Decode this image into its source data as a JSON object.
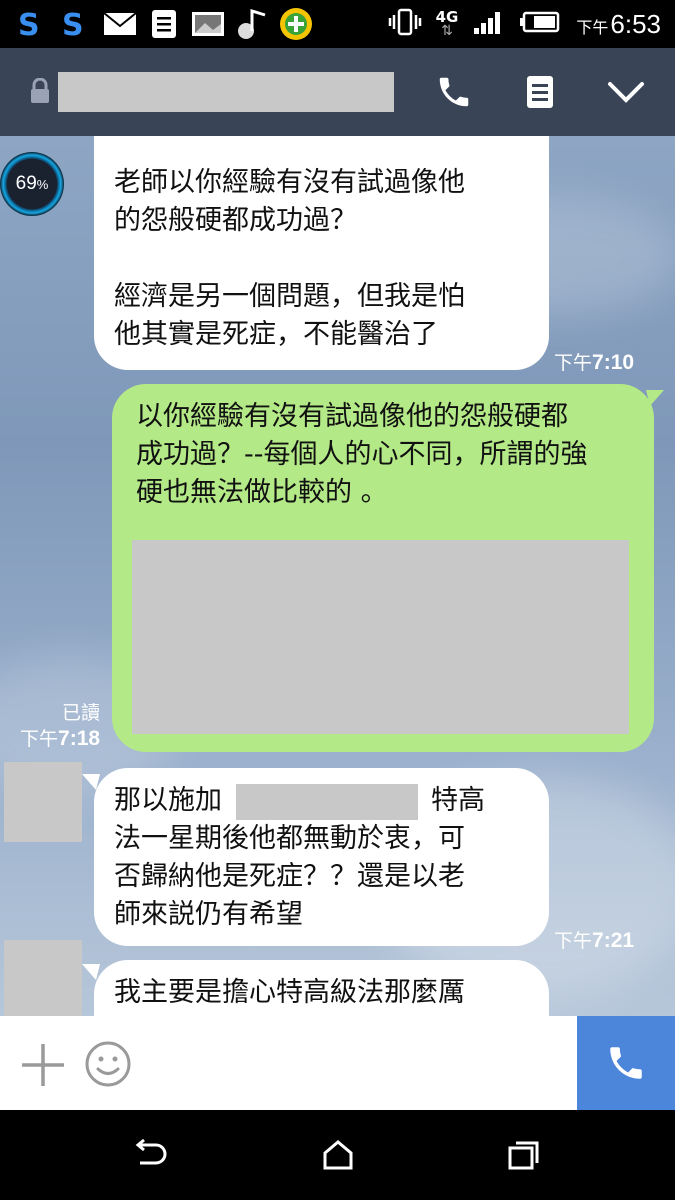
{
  "status_bar": {
    "time_prefix": "下午",
    "time": "6:53",
    "network": "4G"
  },
  "chat": {
    "battery_widget": {
      "value": "69",
      "unit": "%"
    },
    "messages": [
      {
        "direction": "incoming",
        "text": "老師以你經驗有沒有試過像他\n的怨般硬都成功過？\n\n經濟是另一個問題，但我是怕\n他其實是死症，不能醫治了",
        "time_prefix": "下午",
        "time": "7:10"
      },
      {
        "direction": "outgoing",
        "text": "以你經驗有沒有試過像他的怨般硬都\n成功過？--每個人的心不同，所謂的強\n硬也無法做比較的 。",
        "read": "已讀",
        "time_prefix": "下午",
        "time": "7:18"
      },
      {
        "direction": "incoming",
        "text_before": "那以施加",
        "text_after": "，特高",
        "text_rest": "法一星期後他都無動於衷，可\n否歸納他是死症？？還是以老\n師來説仍有希望",
        "time_prefix": "下午",
        "time": "7:21"
      },
      {
        "direction": "incoming",
        "text": "我主要是擔心特高級法那麼厲"
      }
    ]
  },
  "colors": {
    "header_bg": "#3a4457",
    "outgoing_bubble": "#b4e987",
    "incoming_bubble": "#ffffff",
    "send_button": "#4c86db"
  }
}
